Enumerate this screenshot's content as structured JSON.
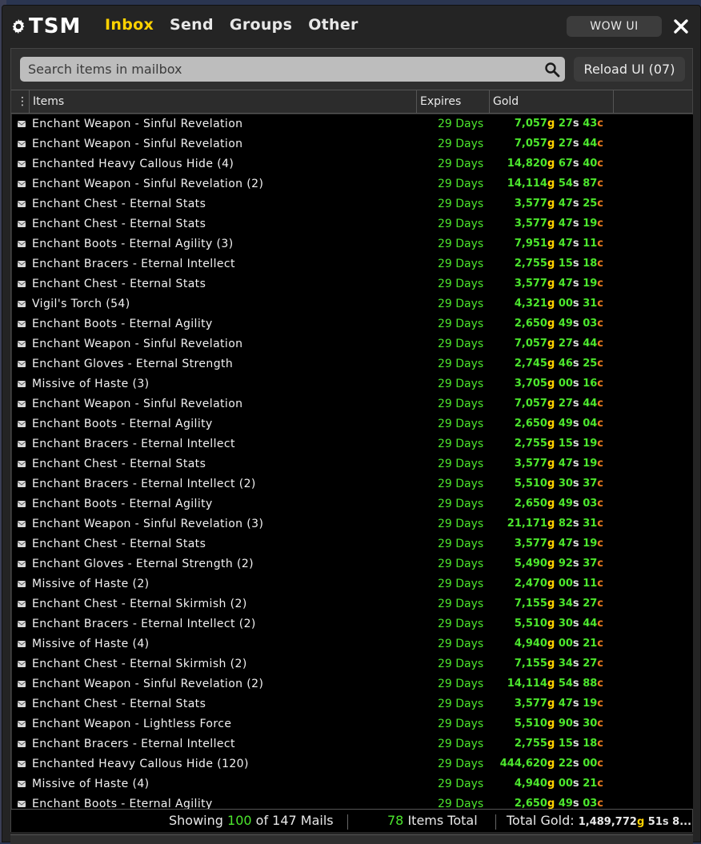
{
  "app": {
    "logo": "TSM"
  },
  "tabs": [
    {
      "label": "Inbox",
      "active": true
    },
    {
      "label": "Send",
      "active": false
    },
    {
      "label": "Groups",
      "active": false
    },
    {
      "label": "Other",
      "active": false
    }
  ],
  "wowui_label": "WOW UI",
  "search": {
    "placeholder": "Search items in mailbox",
    "value": ""
  },
  "reload_label": "Reload UI (07)",
  "columns": {
    "menu": "⋮",
    "items": "Items",
    "expires": "Expires",
    "gold": "Gold"
  },
  "colors": {
    "accent": "#ffd200",
    "green": "#4ce62d",
    "copper": "#ea7b1e",
    "silver": "#dcdcdc"
  },
  "rows": [
    {
      "item": "Enchant Weapon - Sinful Revelation",
      "expires": "29 Days",
      "gold": "7,057",
      "silver": "27",
      "copper": "43"
    },
    {
      "item": "Enchant Weapon - Sinful Revelation",
      "expires": "29 Days",
      "gold": "7,057",
      "silver": "27",
      "copper": "44"
    },
    {
      "item": "Enchanted Heavy Callous Hide (4)",
      "expires": "29 Days",
      "gold": "14,820",
      "silver": "67",
      "copper": "40"
    },
    {
      "item": "Enchant Weapon - Sinful Revelation (2)",
      "expires": "29 Days",
      "gold": "14,114",
      "silver": "54",
      "copper": "87"
    },
    {
      "item": "Enchant Chest - Eternal Stats",
      "expires": "29 Days",
      "gold": "3,577",
      "silver": "47",
      "copper": "25"
    },
    {
      "item": "Enchant Chest - Eternal Stats",
      "expires": "29 Days",
      "gold": "3,577",
      "silver": "47",
      "copper": "19"
    },
    {
      "item": "Enchant Boots - Eternal Agility (3)",
      "expires": "29 Days",
      "gold": "7,951",
      "silver": "47",
      "copper": "11"
    },
    {
      "item": "Enchant Bracers - Eternal Intellect",
      "expires": "29 Days",
      "gold": "2,755",
      "silver": "15",
      "copper": "18"
    },
    {
      "item": "Enchant Chest - Eternal Stats",
      "expires": "29 Days",
      "gold": "3,577",
      "silver": "47",
      "copper": "19"
    },
    {
      "item": "Vigil's Torch (54)",
      "expires": "29 Days",
      "gold": "4,321",
      "silver": "00",
      "copper": "31"
    },
    {
      "item": "Enchant Boots - Eternal Agility",
      "expires": "29 Days",
      "gold": "2,650",
      "silver": "49",
      "copper": "03"
    },
    {
      "item": "Enchant Weapon - Sinful Revelation",
      "expires": "29 Days",
      "gold": "7,057",
      "silver": "27",
      "copper": "44"
    },
    {
      "item": "Enchant Gloves - Eternal Strength",
      "expires": "29 Days",
      "gold": "2,745",
      "silver": "46",
      "copper": "25"
    },
    {
      "item": "Missive of Haste (3)",
      "expires": "29 Days",
      "gold": "3,705",
      "silver": "00",
      "copper": "16"
    },
    {
      "item": "Enchant Weapon - Sinful Revelation",
      "expires": "29 Days",
      "gold": "7,057",
      "silver": "27",
      "copper": "44"
    },
    {
      "item": "Enchant Boots - Eternal Agility",
      "expires": "29 Days",
      "gold": "2,650",
      "silver": "49",
      "copper": "04"
    },
    {
      "item": "Enchant Bracers - Eternal Intellect",
      "expires": "29 Days",
      "gold": "2,755",
      "silver": "15",
      "copper": "19"
    },
    {
      "item": "Enchant Chest - Eternal Stats",
      "expires": "29 Days",
      "gold": "3,577",
      "silver": "47",
      "copper": "19"
    },
    {
      "item": "Enchant Bracers - Eternal Intellect (2)",
      "expires": "29 Days",
      "gold": "5,510",
      "silver": "30",
      "copper": "37"
    },
    {
      "item": "Enchant Boots - Eternal Agility",
      "expires": "29 Days",
      "gold": "2,650",
      "silver": "49",
      "copper": "03"
    },
    {
      "item": "Enchant Weapon - Sinful Revelation (3)",
      "expires": "29 Days",
      "gold": "21,171",
      "silver": "82",
      "copper": "31"
    },
    {
      "item": "Enchant Chest - Eternal Stats",
      "expires": "29 Days",
      "gold": "3,577",
      "silver": "47",
      "copper": "19"
    },
    {
      "item": "Enchant Gloves - Eternal Strength (2)",
      "expires": "29 Days",
      "gold": "5,490",
      "silver": "92",
      "copper": "37"
    },
    {
      "item": "Missive of Haste (2)",
      "expires": "29 Days",
      "gold": "2,470",
      "silver": "00",
      "copper": "11"
    },
    {
      "item": "Enchant Chest - Eternal Skirmish (2)",
      "expires": "29 Days",
      "gold": "7,155",
      "silver": "34",
      "copper": "27"
    },
    {
      "item": "Enchant Bracers - Eternal Intellect (2)",
      "expires": "29 Days",
      "gold": "5,510",
      "silver": "30",
      "copper": "44"
    },
    {
      "item": "Missive of Haste (4)",
      "expires": "29 Days",
      "gold": "4,940",
      "silver": "00",
      "copper": "21"
    },
    {
      "item": "Enchant Chest - Eternal Skirmish (2)",
      "expires": "29 Days",
      "gold": "7,155",
      "silver": "34",
      "copper": "27"
    },
    {
      "item": "Enchant Weapon - Sinful Revelation (2)",
      "expires": "29 Days",
      "gold": "14,114",
      "silver": "54",
      "copper": "88"
    },
    {
      "item": "Enchant Chest - Eternal Stats",
      "expires": "29 Days",
      "gold": "3,577",
      "silver": "47",
      "copper": "19"
    },
    {
      "item": "Enchant Weapon - Lightless Force",
      "expires": "29 Days",
      "gold": "5,510",
      "silver": "90",
      "copper": "30"
    },
    {
      "item": "Enchant Bracers - Eternal Intellect",
      "expires": "29 Days",
      "gold": "2,755",
      "silver": "15",
      "copper": "18"
    },
    {
      "item": "Enchanted Heavy Callous Hide (120)",
      "expires": "29 Days",
      "gold": "444,620",
      "silver": "22",
      "copper": "00"
    },
    {
      "item": "Missive of Haste (4)",
      "expires": "29 Days",
      "gold": "4,940",
      "silver": "00",
      "copper": "21"
    },
    {
      "item": "Enchant Boots - Eternal Agility",
      "expires": "29 Days",
      "gold": "2,650",
      "silver": "49",
      "copper": "03"
    }
  ],
  "footer": {
    "showing_prefix": "Showing",
    "showing_count": "100",
    "showing_suffix": "of 147 Mails",
    "items_count": "78",
    "items_label": "Items Total",
    "total_gold_label": "Total Gold:",
    "total_gold": "1,489,772",
    "total_silver": "51",
    "total_rest": "8..."
  },
  "units": {
    "g": "g",
    "s": "s",
    "c": "c"
  }
}
